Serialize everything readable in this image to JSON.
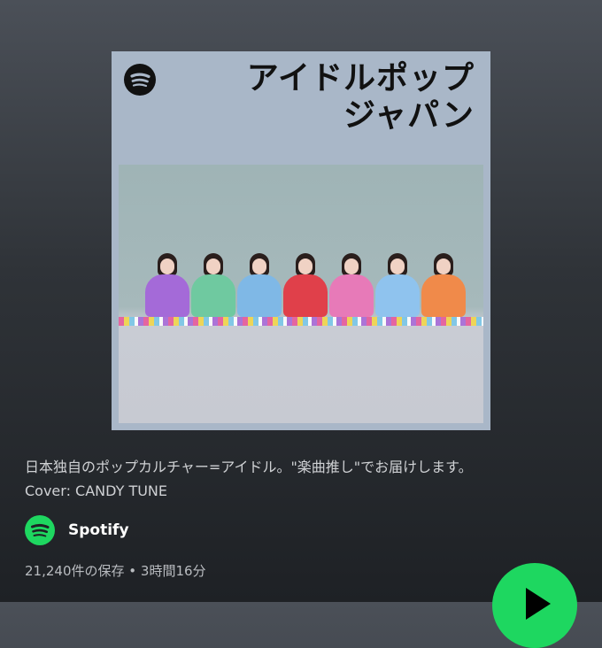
{
  "playlist": {
    "cover": {
      "title_line1": "アイドルポップ",
      "title_line2": "ジャパン",
      "logo_icon": "spotify-logo-icon",
      "background_color": "#a9b7c8"
    },
    "description_line1": "日本独自のポップカルチャー=アイドル。\"楽曲推し\"でお届けします。",
    "description_line2": "Cover: CANDY TUNE",
    "owner": {
      "name": "Spotify",
      "avatar_icon": "spotify-logo-icon"
    },
    "stats": {
      "saves": "21,240件の保存",
      "separator": "•",
      "duration": "3時間16分"
    },
    "play_icon": "play-icon",
    "accent_color": "#1ed760"
  }
}
